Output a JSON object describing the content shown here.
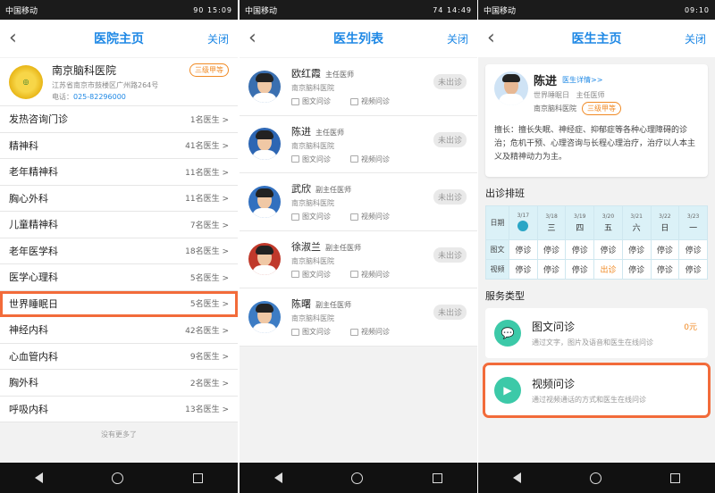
{
  "status": {
    "s1": {
      "carrier": "中国移动",
      "right": "90 15:09"
    },
    "s2": {
      "carrier": "中国移动",
      "right": "74 14:49"
    },
    "s3": {
      "carrier": "中国移动",
      "right": "09:10"
    }
  },
  "screen1": {
    "nav": {
      "back": "‹",
      "title": "医院主页",
      "close": "关闭"
    },
    "hospital": {
      "name": "南京脑科医院",
      "grade": "三级甲等",
      "address": "江苏省南京市鼓楼区广州路264号",
      "tel_label": "电话：",
      "tel": "025-82296000"
    },
    "departments": [
      {
        "name": "发热咨询门诊",
        "count": "1名医生 >"
      },
      {
        "name": "精神科",
        "count": "41名医生 >"
      },
      {
        "name": "老年精神科",
        "count": "11名医生 >"
      },
      {
        "name": "胸心外科",
        "count": "11名医生 >"
      },
      {
        "name": "儿童精神科",
        "count": "7名医生 >"
      },
      {
        "name": "老年医学科",
        "count": "18名医生 >"
      },
      {
        "name": "医学心理科",
        "count": "5名医生 >"
      },
      {
        "name": "世界睡眠日",
        "count": "5名医生 >"
      },
      {
        "name": "神经内科",
        "count": "42名医生 >"
      },
      {
        "name": "心血管内科",
        "count": "9名医生 >"
      },
      {
        "name": "胸外科",
        "count": "2名医生 >"
      },
      {
        "name": "呼吸内科",
        "count": "13名医生 >"
      }
    ],
    "no_more": "没有更多了"
  },
  "screen2": {
    "nav": {
      "back": "‹",
      "title": "医生列表",
      "close": "关闭"
    },
    "doctors": [
      {
        "name": "欧红霞",
        "title": "主任医师",
        "hospital": "南京脑科医院",
        "svc1": "图文问诊",
        "svc2": "视频问诊",
        "status": "未出诊"
      },
      {
        "name": "陈进",
        "title": "主任医师",
        "hospital": "南京脑科医院",
        "svc1": "图文问诊",
        "svc2": "视频问诊",
        "status": "未出诊"
      },
      {
        "name": "武欣",
        "title": "副主任医师",
        "hospital": "南京脑科医院",
        "svc1": "图文问诊",
        "svc2": "视频问诊",
        "status": "未出诊"
      },
      {
        "name": "徐淑兰",
        "title": "副主任医师",
        "hospital": "南京脑科医院",
        "svc1": "图文问诊",
        "svc2": "视频问诊",
        "status": "未出诊"
      },
      {
        "name": "陈曙",
        "title": "副主任医师",
        "hospital": "南京脑科医院",
        "svc1": "图文问诊",
        "svc2": "视频问诊",
        "status": "未出诊"
      }
    ]
  },
  "screen3": {
    "nav": {
      "back": "‹",
      "title": "医生主页",
      "close": "关闭"
    },
    "doctor": {
      "name": "陈进",
      "detail_link": "医生详情>>",
      "dept": "世界睡眠日",
      "title": "主任医师",
      "hospital": "南京脑科医院",
      "grade": "三级甲等",
      "desc": "擅长：擅长失眠、神经症、抑郁症等各种心理障碍的诊治；危机干预、心理咨询与长程心理治疗，治疗以人本主义及精神动力为主。"
    },
    "schedule_title": "出诊排班",
    "schedule": {
      "label_date": "日期",
      "label_text": "图文",
      "label_video": "视频",
      "days": [
        {
          "date": "3/17",
          "week": ""
        },
        {
          "date": "3/18",
          "week": "三"
        },
        {
          "date": "3/19",
          "week": "四"
        },
        {
          "date": "3/20",
          "week": "五"
        },
        {
          "date": "3/21",
          "week": "六"
        },
        {
          "date": "3/22",
          "week": "日"
        },
        {
          "date": "3/23",
          "week": "一"
        }
      ],
      "text_row": [
        "停诊",
        "停诊",
        "停诊",
        "停诊",
        "停诊",
        "停诊",
        "停诊"
      ],
      "video_row": [
        "停诊",
        "停诊",
        "停诊",
        "出诊",
        "停诊",
        "停诊",
        "停诊"
      ]
    },
    "services_title": "服务类型",
    "services": [
      {
        "name": "图文问诊",
        "desc": "通过文字，图片及语音和医生在线问诊",
        "price": "0元"
      },
      {
        "name": "视频问诊",
        "desc": "通过视频通话的方式和医生在线问诊",
        "price": ""
      }
    ]
  },
  "colors": {
    "accent": "#1e88e5",
    "highlight": "#f26b3a",
    "orange": "#f08a24",
    "teal": "#3cc9a8"
  }
}
